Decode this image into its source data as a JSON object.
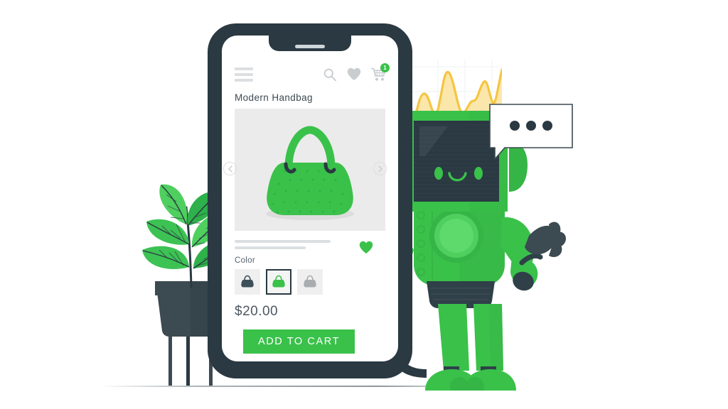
{
  "scene": {
    "title": "Mobile Shopping App Illustration",
    "background_color": "#ffffff",
    "accent_green": "#3ac14a",
    "dark_slate": "#2a3942",
    "crown_yellow": "#fbd96b"
  },
  "phone": {
    "frame_color": "#2a3942",
    "screen_color": "#ffffff"
  },
  "app": {
    "header": {
      "menu_icon": "hamburger-icon",
      "search_icon": "search-icon",
      "wishlist_icon": "heart-icon",
      "cart_icon": "shopping-cart-icon",
      "cart_count": "1"
    },
    "product": {
      "title": "Modern Handbag",
      "gallery_image_alt": "green-handbag",
      "prev_label": "‹",
      "next_label": "›",
      "favorite_icon": "heart-filled-icon",
      "color_label": "Color",
      "swatches": [
        {
          "name": "dark-slate",
          "color": "#3d5059",
          "selected": false
        },
        {
          "name": "green",
          "color": "#3ac14a",
          "selected": true
        },
        {
          "name": "gray",
          "color": "#a9adaf",
          "selected": false
        }
      ],
      "price": "$20.00",
      "add_to_cart_label": "ADD TO CART"
    }
  },
  "robot": {
    "name": "shopping-assistant-robot",
    "body_color": "#3ac14a",
    "screen_color": "#2a3942",
    "eye_color": "#3ac14a",
    "crown_color": "#fbd96b"
  },
  "speech_bubble": {
    "content": "typing-dots",
    "dot_count": 3
  },
  "plant": {
    "name": "potted-plant",
    "leaf_count": 6,
    "pot_color": "#3c4a51"
  }
}
